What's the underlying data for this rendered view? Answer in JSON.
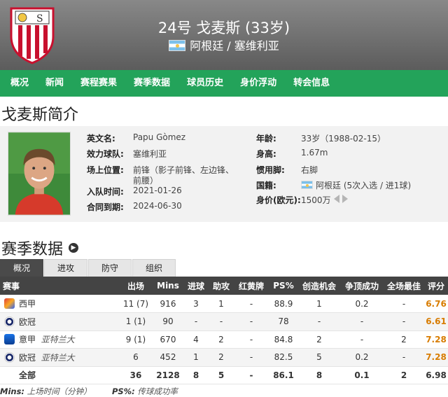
{
  "header": {
    "title": "24号 戈麦斯 (33岁)",
    "nationality_club": "阿根廷 / 塞维利亚"
  },
  "nav": [
    "概况",
    "新闻",
    "赛程赛果",
    "赛季数据",
    "球员历史",
    "身价浮动",
    "转会信息"
  ],
  "profile": {
    "section_title": "戈麦斯简介",
    "fields_left": [
      {
        "label": "英文名:",
        "value": "Papu Gòmez"
      },
      {
        "label": "效力球队:",
        "value": "塞维利亚"
      },
      {
        "label": "场上位置:",
        "value": "前锋（影子前锋、左边锋、",
        "value2": "前腰）"
      },
      {
        "label": "入队时间:",
        "value": "2021-01-26"
      },
      {
        "label": "合同到期:",
        "value": "2024-06-30"
      }
    ],
    "fields_right": [
      {
        "label": "年龄:",
        "value": "33岁（1988-02-15）"
      },
      {
        "label": "身高:",
        "value": "1.67m"
      },
      {
        "label": "惯用脚:",
        "value": "右脚"
      },
      {
        "label": "国籍:",
        "value": "阿根廷 (5次入选 / 进1球)"
      },
      {
        "label": "身价(欧元):",
        "value": "1500万"
      }
    ]
  },
  "season": {
    "section_title": "赛季数据",
    "tabs": [
      "概况",
      "进攻",
      "防守",
      "组织"
    ],
    "columns": [
      "赛事",
      "出场",
      "Mins",
      "进球",
      "助攻",
      "红黄牌",
      "PS%",
      "创造机会",
      "争顶成功",
      "全场最佳",
      "评分"
    ],
    "rows": [
      {
        "icon": "laliga-icon",
        "comp": "西甲",
        "team": "",
        "apps": "11 (7)",
        "mins": "916",
        "goals": "3",
        "assists": "1",
        "cards": "-",
        "ps": "88.9",
        "chances": "1",
        "aerial": "0.2",
        "motm": "-",
        "rating": "6.76"
      },
      {
        "icon": "ucl-icon",
        "comp": "欧冠",
        "team": "",
        "apps": "1 (1)",
        "mins": "90",
        "goals": "-",
        "assists": "-",
        "cards": "-",
        "ps": "78",
        "chances": "-",
        "aerial": "-",
        "motm": "-",
        "rating": "6.61"
      },
      {
        "icon": "seriea-icon",
        "comp": "意甲",
        "team": "亚特兰大",
        "apps": "9 (1)",
        "mins": "670",
        "goals": "4",
        "assists": "2",
        "cards": "-",
        "ps": "84.8",
        "chances": "2",
        "aerial": "-",
        "motm": "2",
        "rating": "7.28"
      },
      {
        "icon": "ucl-icon",
        "comp": "欧冠",
        "team": "亚特兰大",
        "apps": "6",
        "mins": "452",
        "goals": "1",
        "assists": "2",
        "cards": "-",
        "ps": "82.5",
        "chances": "5",
        "aerial": "0.2",
        "motm": "-",
        "rating": "7.28"
      }
    ],
    "total": {
      "comp": "全部",
      "apps": "36",
      "mins": "2128",
      "goals": "8",
      "assists": "5",
      "cards": "-",
      "ps": "86.1",
      "chances": "8",
      "aerial": "0.1",
      "motm": "2",
      "rating": "6.98"
    }
  },
  "footnote": {
    "mins_key": "Mins:",
    "mins_text": " 上场时间（分钟）",
    "ps_key": "PS%:",
    "ps_text": " 传球成功率"
  },
  "colors": {
    "nav_bg": "#23a35a",
    "rating": "#d87c00",
    "header_bg": "#6e6e6e"
  }
}
